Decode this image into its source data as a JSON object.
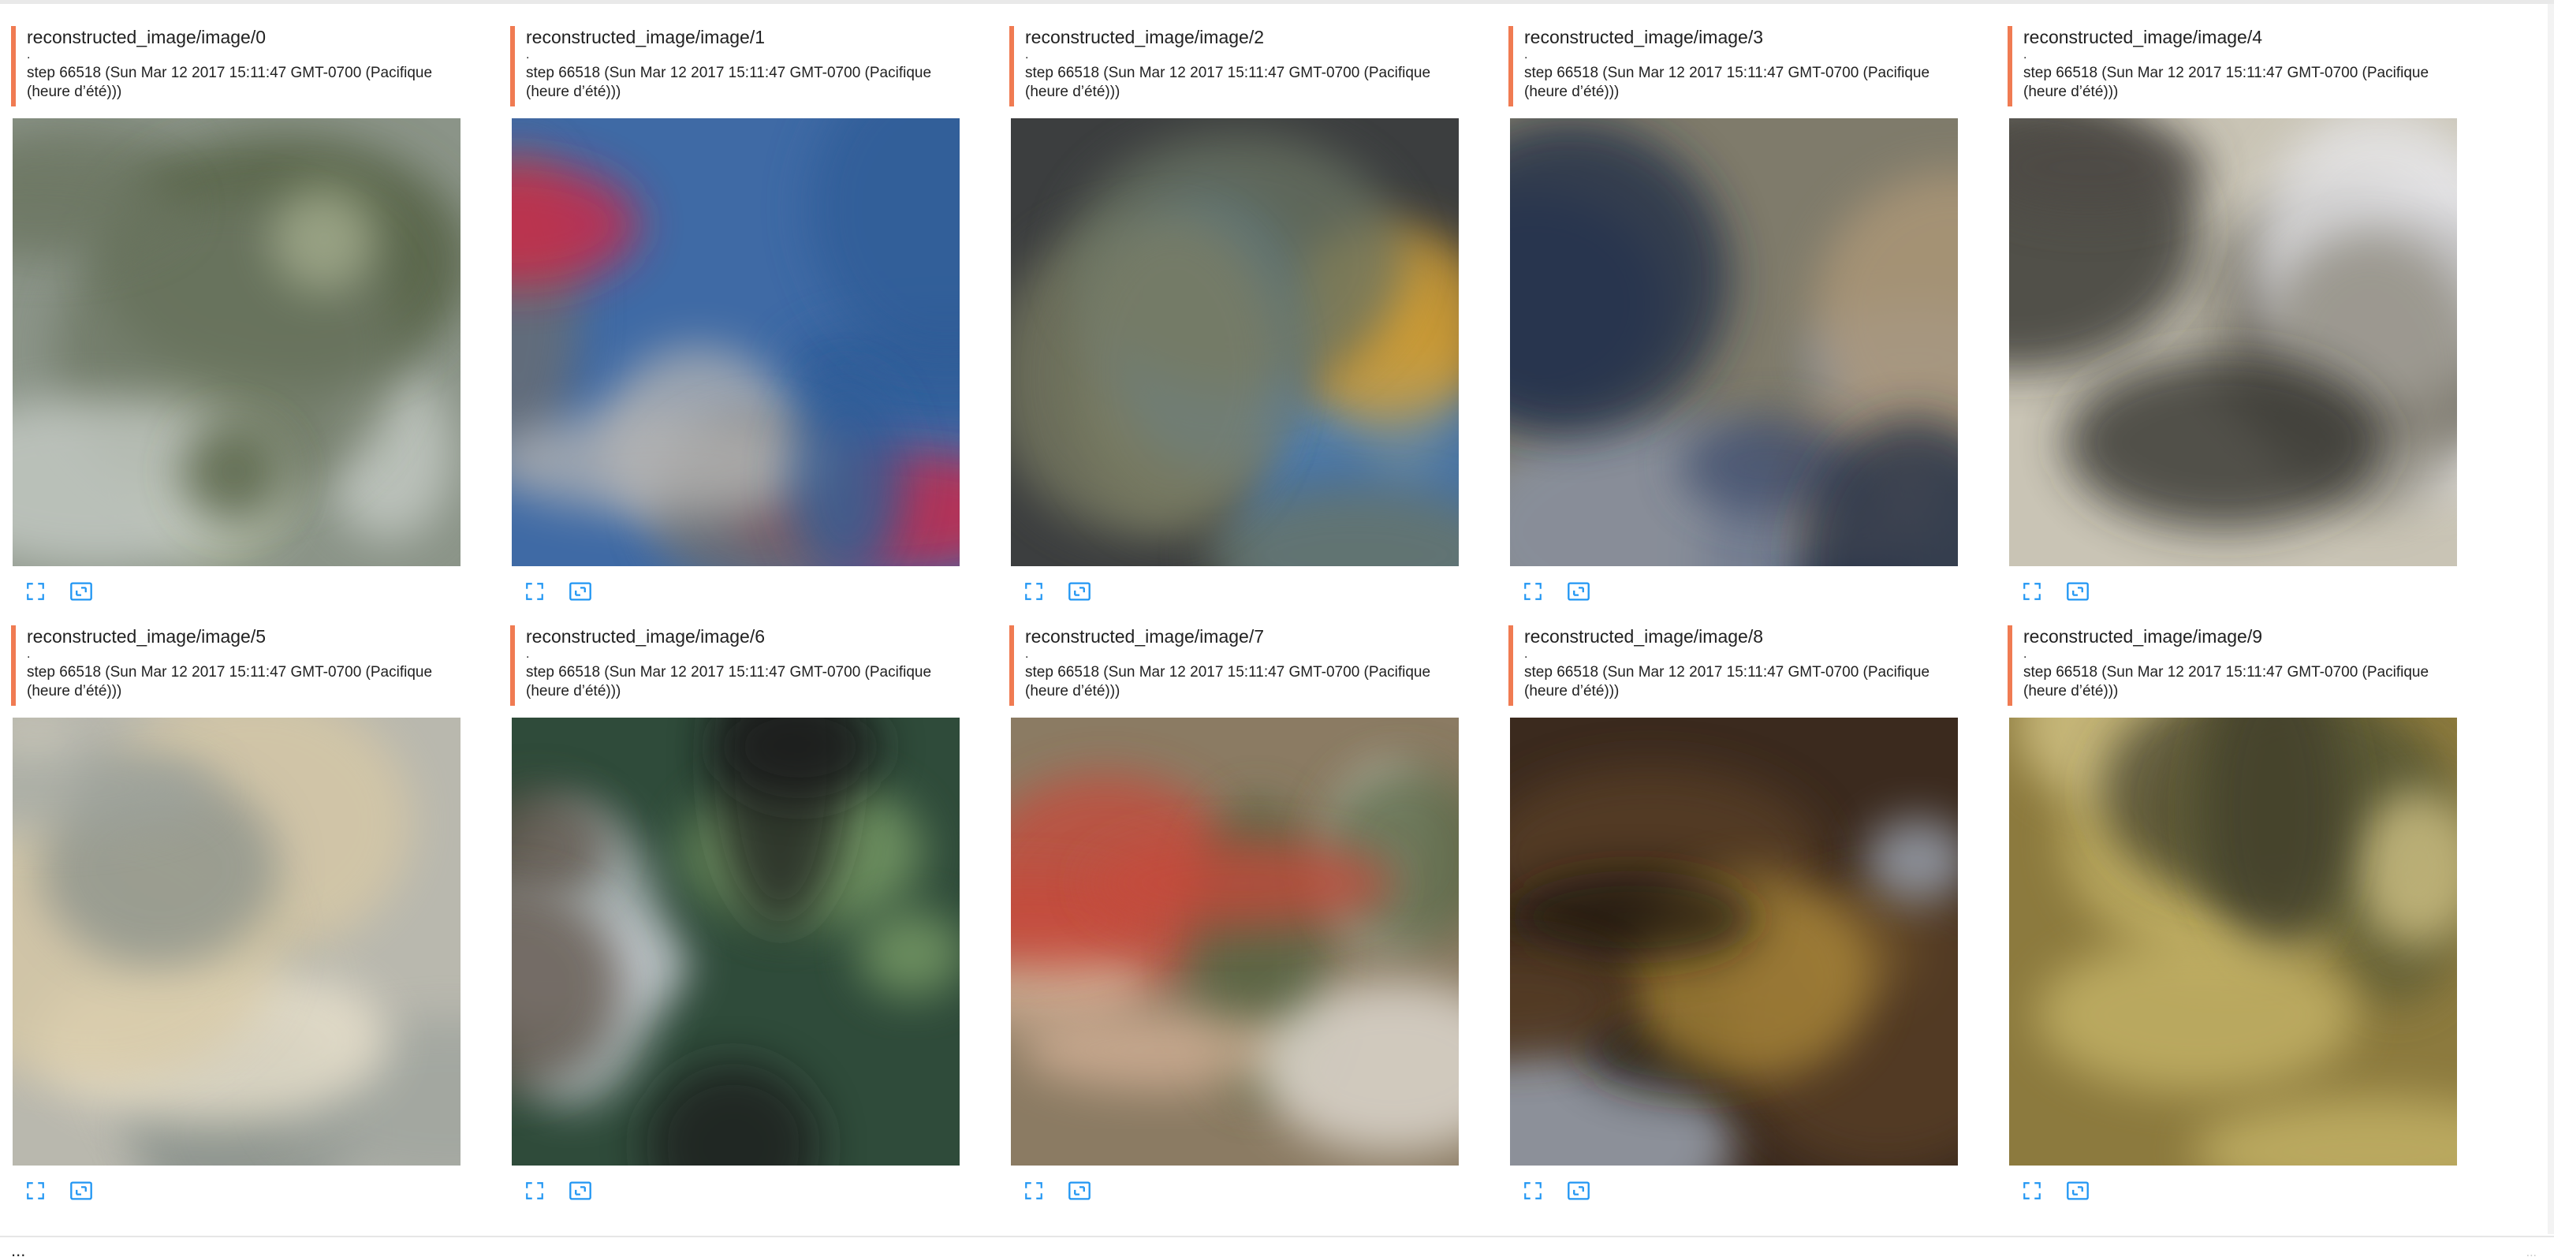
{
  "cards": [
    {
      "title": "reconstructed_image/image/0",
      "dot": ".",
      "step": "step 66518 (Sun Mar 12 2017 15:11:47 GMT-0700 (Pacifique (heure d’été)))",
      "colors": [
        "#8b9488",
        "#6d7763",
        "#c9cfc9",
        "#a8b191",
        "#4d5a3b"
      ]
    },
    {
      "title": "reconstructed_image/image/1",
      "dot": ".",
      "step": "step 66518 (Sun Mar 12 2017 15:11:47 GMT-0700 (Pacifique (heure d’été)))",
      "colors": [
        "#3f6aa5",
        "#2d5b96",
        "#d8233f",
        "#6d6d6d",
        "#b7b6b4"
      ]
    },
    {
      "title": "reconstructed_image/image/2",
      "dot": ".",
      "step": "step 66518 (Sun Mar 12 2017 15:11:47 GMT-0700 (Pacifique (heure d’été)))",
      "colors": [
        "#3c3e3f",
        "#7a7d63",
        "#d5a135",
        "#4b84c4",
        "#6b7563"
      ]
    },
    {
      "title": "reconstructed_image/image/3",
      "dot": ".",
      "step": "step 66518 (Sun Mar 12 2017 15:11:47 GMT-0700 (Pacifique (heure d’été)))",
      "colors": [
        "#7f7b6b",
        "#1f2a44",
        "#8b94a8",
        "#b19a78",
        "#3c4b6b"
      ]
    },
    {
      "title": "reconstructed_image/image/4",
      "dot": ".",
      "step": "step 66518 (Sun Mar 12 2017 15:11:47 GMT-0700 (Pacifique (heure d’été)))",
      "colors": [
        "#c9c4b5",
        "#2c2a28",
        "#e8e8ec",
        "#8e8a7e",
        "#4d4a45"
      ]
    },
    {
      "title": "reconstructed_image/image/5",
      "dot": ".",
      "step": "step 66518 (Sun Mar 12 2017 15:11:47 GMT-0700 (Pacifique (heure d’été)))",
      "colors": [
        "#b9b8ae",
        "#9ca29c",
        "#efe6d0",
        "#d8c9a5",
        "#88908a"
      ]
    },
    {
      "title": "reconstructed_image/image/6",
      "dot": ".",
      "step": "step 66518 (Sun Mar 12 2017 15:11:47 GMT-0700 (Pacifique (heure d’été)))",
      "colors": [
        "#2f4b3a",
        "#1b1d1f",
        "#7fa36a",
        "#c9cfd4",
        "#5b4f45"
      ]
    },
    {
      "title": "reconstructed_image/image/7",
      "dot": ".",
      "step": "step 66518 (Sun Mar 12 2017 15:11:47 GMT-0700 (Pacifique (heure d’été)))",
      "colors": [
        "#8b7b63",
        "#c74a3a",
        "#d7b49a",
        "#50603e",
        "#e7e3dc"
      ]
    },
    {
      "title": "reconstructed_image/image/8",
      "dot": ".",
      "step": "step 66518 (Sun Mar 12 2017 15:11:47 GMT-0700 (Pacifique (heure d’été)))",
      "colors": [
        "#3b2a1e",
        "#5a3f27",
        "#a7b2c2",
        "#b08c3a",
        "#1c1208"
      ]
    },
    {
      "title": "reconstructed_image/image/9",
      "dot": ".",
      "step": "step 66518 (Sun Mar 12 2017 15:11:47 GMT-0700 (Pacifique (heure d’été)))",
      "colors": [
        "#8c7a3e",
        "#c9b86a",
        "#5a5a35",
        "#d8c98b",
        "#3f3e2a"
      ]
    }
  ],
  "icons": {
    "fullscreen": "fullscreen-icon",
    "actual_size": "actual-size-icon",
    "accent_color": "#2196f3",
    "header_bar_color": "#f07b52"
  },
  "footer": {
    "left_text": "...",
    "corner_text": "..."
  }
}
